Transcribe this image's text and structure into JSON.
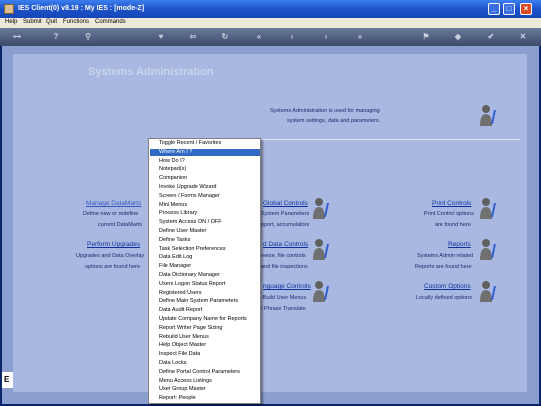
{
  "window": {
    "title": "IES Client(0) v8.19 : My IES :      [mode-Z]"
  },
  "menubar": [
    "Help",
    "Submit",
    "Quit",
    "Functions",
    "Commands"
  ],
  "toolbar_icons": [
    "key-icon",
    "help-icon",
    "search-icon",
    "heart-icon",
    "back-icon",
    "refresh-icon",
    "first-icon",
    "prev-icon",
    "next-icon",
    "last-icon",
    "bookmark-icon",
    "save-icon",
    "ok-icon",
    "cancel-icon"
  ],
  "page": {
    "title": "Systems Administration",
    "intro_line1": "Systems Administration is used for managing",
    "intro_line2": "system settings, data and parameters."
  },
  "sections": {
    "manage_datamarts": {
      "title": "Manage DataMarts",
      "l1": "Define new or redefine",
      "l2": "current DataMarts"
    },
    "perform_upgrades": {
      "title": "Perform Upgrades",
      "l1": "Upgrades and Data Overlay",
      "l2": "options are found here"
    },
    "global_controls": {
      "title": "Global Controls",
      "l1": "System Parameters",
      "l2": "pport, accumulators"
    },
    "data_controls": {
      "title": "d Data Controls",
      "l1": "reeze, file controls",
      "l2": "and file inspections"
    },
    "language_controls": {
      "title": "nguage Controls",
      "l1": "-Build User Menus",
      "l2": "/ Phrase Translate"
    },
    "print_controls": {
      "title": "Print Controls",
      "l1": "Print Control options",
      "l2": "are found here"
    },
    "reports": {
      "title": "Reports",
      "l1": "Systems Admin related",
      "l2": "Reports are found here"
    },
    "custom_options": {
      "title": "Custom Options",
      "l1": "Locally defined options",
      "l2": ""
    }
  },
  "left_strip": "E",
  "popup_menu": [
    "Toggle Recent / Favorites",
    "Where Am I ?",
    "How Do I?",
    "Notepad(s)",
    "Companion",
    "Invoke Upgrade Wizard",
    "Screen / Forms Manager",
    "Mini Menus",
    "Process Library",
    "System Access ON / OFF",
    "Define User Master",
    "Define Tasks",
    "Task Selection Preferences",
    "Data Edit Log",
    "File Manager",
    "Data Dictionary Manager",
    "Users Logon Status Report",
    "Registered Users",
    "Define Main System Parameters",
    "Data Audit Report",
    "Update Company Name for Reports",
    "Report Writer Page Sizing",
    "Rebuild User Menus",
    "Help Object Master",
    "Inspect File Data",
    "Data Locks",
    "Define Portal Control Parameters",
    "Menu Access Listings",
    "User Group Master",
    "Report: People"
  ],
  "popup_selected_index": 1
}
